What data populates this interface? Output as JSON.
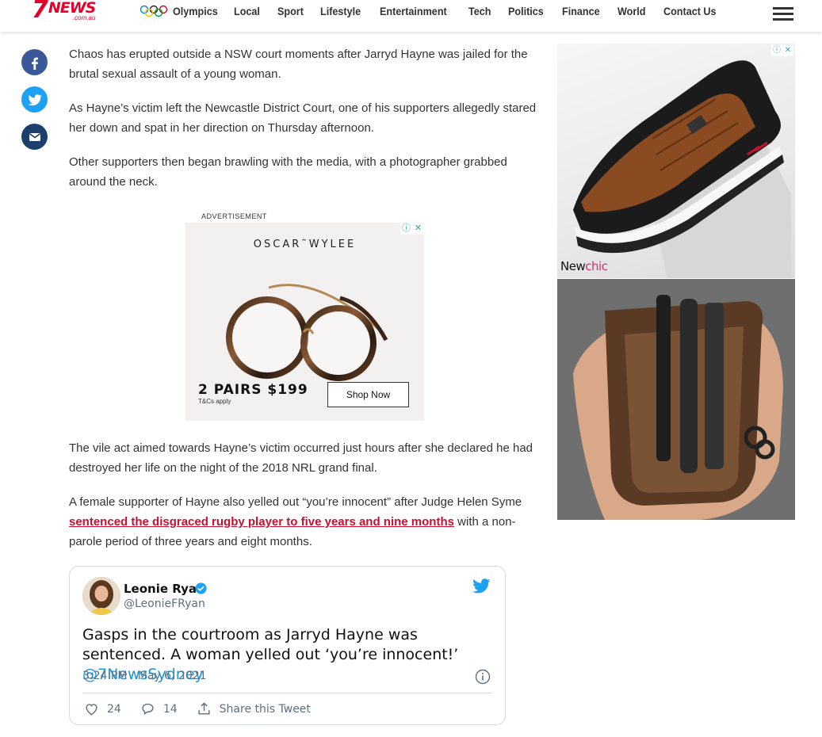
{
  "header": {
    "logo_seven": "7",
    "logo_news": "NEWS",
    "logo_domain": ".com.au",
    "nav": [
      "Olympics",
      "Local",
      "Sport",
      "Lifestyle",
      "Entertainment",
      "Tech",
      "Politics",
      "Finance",
      "World",
      "Contact Us"
    ]
  },
  "share": {
    "facebook_color": "#3b5998",
    "twitter_color": "#1da1f2",
    "email_color": "#1c3f6e"
  },
  "article": {
    "p1": "Chaos has erupted outside a NSW court moments after Jarryd Hayne was jailed for the brutal sexual assault of a young woman.",
    "p2": "As Hayne’s victim left the Newcastle District Court, one of his supporters allegedly stared her down and spat in her direction on Thursday afternoon.",
    "p3": "Other supporters then began brawling with the media, with a photographer grabbed around the neck.",
    "p4": "The vile act aimed towards Hayne’s victim occurred just hours after she declared he had destroyed her life on the night of the 2018 NRL grand final.",
    "p5_before": "A female supporter of Hayne also yelled out “you’re innocent” after Judge Helen Syme ",
    "p5_link": "sentenced the disgraced rugby player to five years and nine months",
    "p5_after": " with a non-parole period of three years and eight months."
  },
  "inline_ad": {
    "label": "ADVERTISEMENT",
    "brand": "OSCAR˜WYLEE",
    "offer": "2 PAIRS $199",
    "offer_sub": "T&Cs apply",
    "button": "Shop Now"
  },
  "tweet": {
    "name": "Leonie Ryan",
    "handle": "@LeonieFRyan",
    "text": "Gasps in the courtroom as Jarryd Hayne was sentenced. A woman yelled out ‘you’re innocent!’ ",
    "mention": "@7NewsSydney",
    "time": "3:24 PM · May 6, 2021",
    "likes": "24",
    "replies": "14",
    "share": "Share this Tweet"
  },
  "side_ads": {
    "ad1_brand_a": "New",
    "ad1_brand_b": "chic"
  },
  "colors": {
    "brand_red": "#e4002b",
    "link_red": "#c8102e",
    "twitter_blue": "#1b95e0"
  }
}
